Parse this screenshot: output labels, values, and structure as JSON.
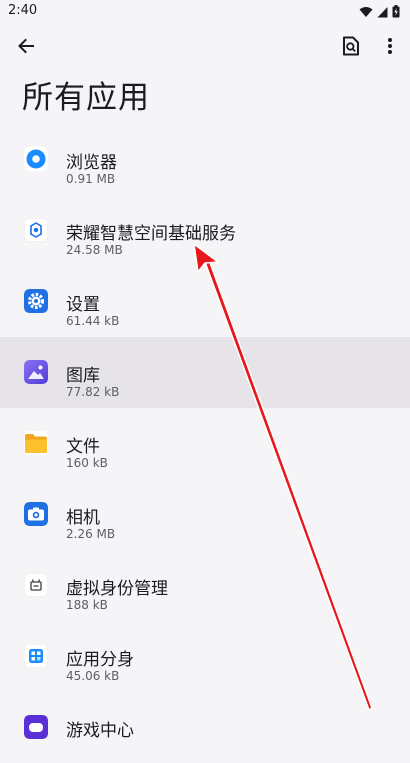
{
  "status": {
    "time": "2:40"
  },
  "page": {
    "title": "所有应用"
  },
  "apps": [
    {
      "name": "浏览器",
      "size": "0.91 MB",
      "icon": "browser-icon"
    },
    {
      "name": "荣耀智慧空间基础服务",
      "size": "24.58 MB",
      "icon": "honor-service-icon"
    },
    {
      "name": "设置",
      "size": "61.44 kB",
      "icon": "settings-icon"
    },
    {
      "name": "图库",
      "size": "77.82 kB",
      "icon": "gallery-icon"
    },
    {
      "name": "文件",
      "size": "160 kB",
      "icon": "files-icon"
    },
    {
      "name": "相机",
      "size": "2.26 MB",
      "icon": "camera-icon"
    },
    {
      "name": "虚拟身份管理",
      "size": "188 kB",
      "icon": "virtual-identity-icon"
    },
    {
      "name": "应用分身",
      "size": "45.06 kB",
      "icon": "app-clone-icon"
    },
    {
      "name": "游戏中心",
      "size": "",
      "icon": "game-center-icon"
    }
  ],
  "colors": {
    "accent": "#1a73e8",
    "highlight": "#e6e4e9",
    "annotation": "#e8171b"
  }
}
